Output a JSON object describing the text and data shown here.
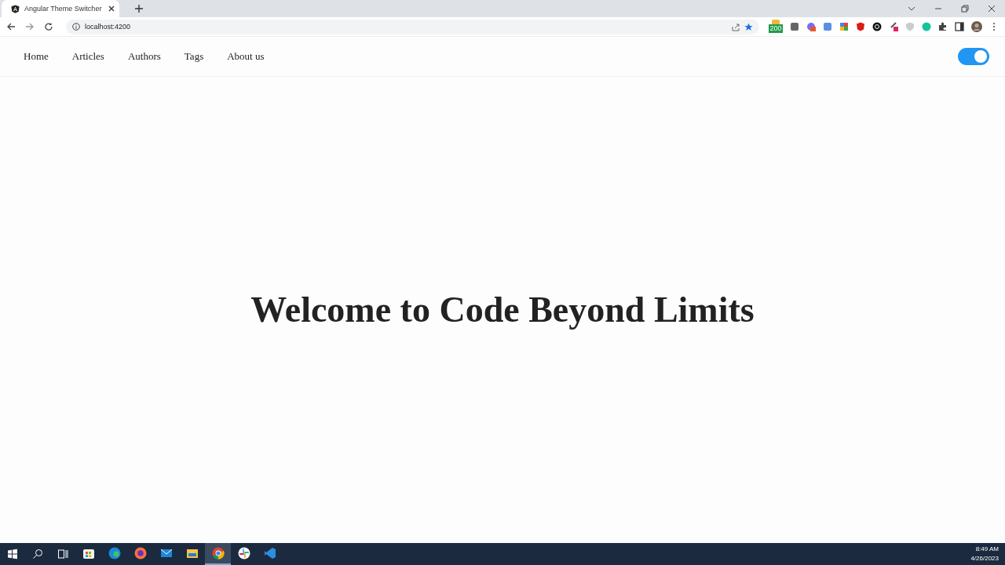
{
  "browser": {
    "tab": {
      "title": "Angular Theme Switcher"
    },
    "address": "localhost:4200",
    "extension_badge": "200"
  },
  "nav": {
    "links": [
      "Home",
      "Articles",
      "Authors",
      "Tags",
      "About us"
    ],
    "theme_toggle": {
      "on": true
    }
  },
  "heading": "Welcome to Code Beyond Limits",
  "taskbar": {
    "apps": [
      {
        "kind": "store",
        "selected": false
      },
      {
        "kind": "edge",
        "selected": false
      },
      {
        "kind": "firefox",
        "selected": false
      },
      {
        "kind": "mail",
        "selected": false
      },
      {
        "kind": "files",
        "selected": false
      },
      {
        "kind": "chrome",
        "selected": true
      },
      {
        "kind": "slack",
        "selected": false
      },
      {
        "kind": "vscode",
        "selected": false
      }
    ],
    "time": "8:49 AM",
    "date": "4/26/2023"
  }
}
